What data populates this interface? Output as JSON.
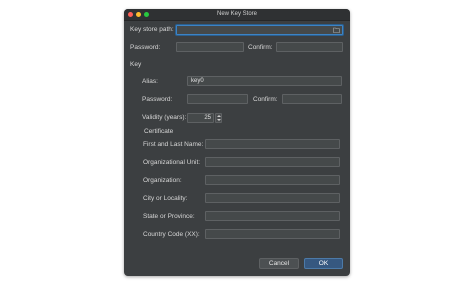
{
  "window": {
    "title": "New Key Store"
  },
  "keystore": {
    "path_label": "Key store path:",
    "path_value": "",
    "password_label": "Password:",
    "confirm_label": "Confirm:"
  },
  "key": {
    "section_label": "Key",
    "alias_label": "Alias:",
    "alias_value": "key0",
    "password_label": "Password:",
    "confirm_label": "Confirm:",
    "validity_label": "Validity (years):",
    "validity_value": "25"
  },
  "certificate": {
    "section_label": "Certificate",
    "fields": [
      {
        "label": "First and Last Name:",
        "value": ""
      },
      {
        "label": "Organizational Unit:",
        "value": ""
      },
      {
        "label": "Organization:",
        "value": ""
      },
      {
        "label": "City or Locality:",
        "value": ""
      },
      {
        "label": "State or Province:",
        "value": ""
      },
      {
        "label": "Country Code (XX):",
        "value": ""
      }
    ]
  },
  "buttons": {
    "cancel": "Cancel",
    "ok": "OK"
  },
  "icons": {
    "browse": "folder-icon",
    "close": "close-icon",
    "minimize": "minimize-icon",
    "zoom": "zoom-icon"
  },
  "colors": {
    "accent": "#3d83c4",
    "window_bg": "#3c3f41",
    "ok_button": "#365880"
  }
}
